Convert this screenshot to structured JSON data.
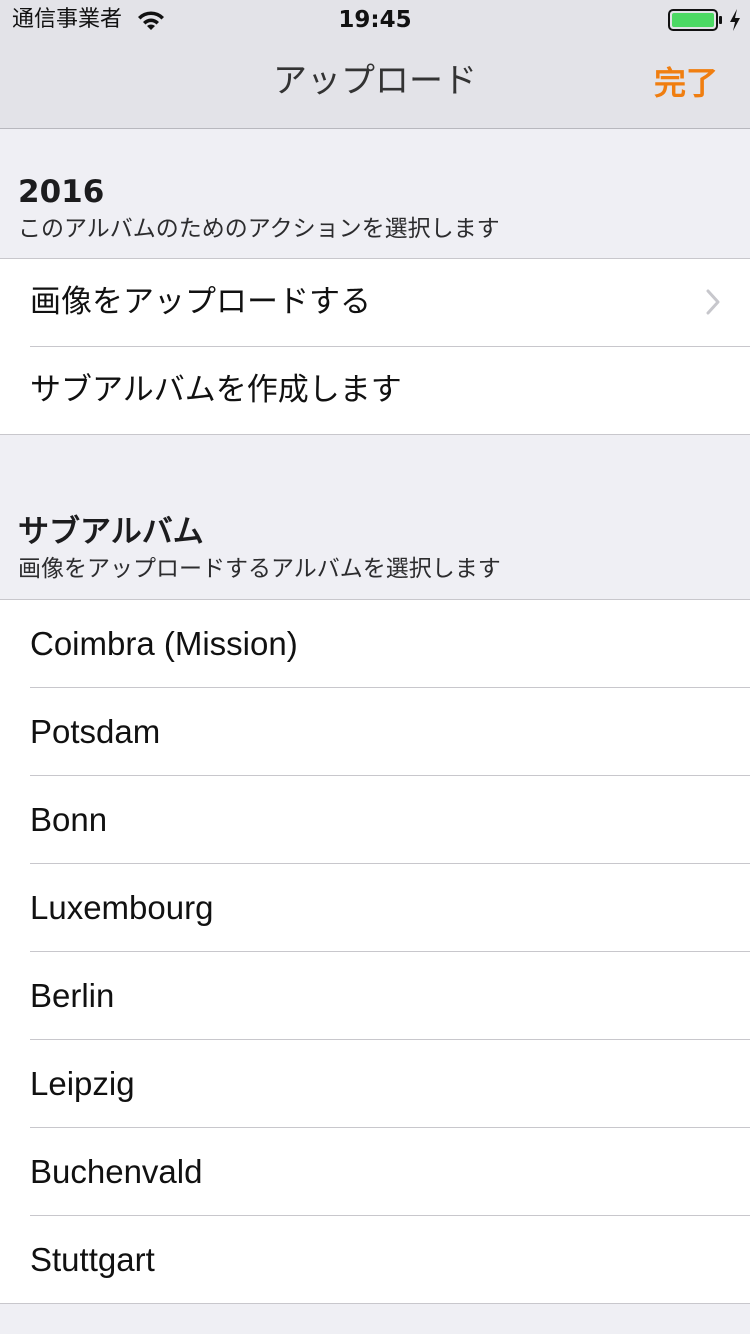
{
  "status_bar": {
    "carrier": "通信事業者",
    "time": "19:45"
  },
  "nav": {
    "title": "アップロード",
    "done_label": "完了"
  },
  "colors": {
    "accent": "#f07e10",
    "battery": "#4cd964",
    "background": "#efeff4",
    "nav_background": "#e3e3e8"
  },
  "section_actions": {
    "title": "2016",
    "subtitle": "このアルバムのためのアクションを選択します",
    "items": [
      {
        "label": "画像をアップロードする",
        "icon": "chevron-right-icon"
      },
      {
        "label": "サブアルバムを作成します"
      }
    ]
  },
  "section_albums": {
    "title": "サブアルバム",
    "subtitle": "画像をアップロードするアルバムを選択します",
    "items": [
      {
        "label": "Coimbra (Mission)"
      },
      {
        "label": "Potsdam"
      },
      {
        "label": "Bonn"
      },
      {
        "label": "Luxembourg"
      },
      {
        "label": "Berlin"
      },
      {
        "label": "Leipzig"
      },
      {
        "label": "Buchenvald"
      },
      {
        "label": "Stuttgart"
      }
    ]
  }
}
